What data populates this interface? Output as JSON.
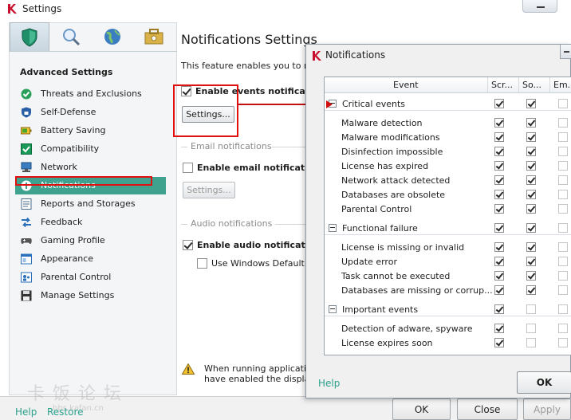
{
  "window": {
    "title": "Settings"
  },
  "tabs": [
    {
      "icon": "shield-icon",
      "color": "#1f8f6a"
    },
    {
      "icon": "magnifier-icon",
      "color": "#6a96c8"
    },
    {
      "icon": "globe-icon",
      "color": "#3a7ec1"
    },
    {
      "icon": "toolbox-icon",
      "color": "#c9a13a"
    }
  ],
  "sidebar": {
    "heading": "Advanced Settings",
    "items": [
      {
        "label": "Threats and Exclusions",
        "icon": "check-circle-icon"
      },
      {
        "label": "Self-Defense",
        "icon": "lock-shield-icon"
      },
      {
        "label": "Battery Saving",
        "icon": "battery-icon"
      },
      {
        "label": "Compatibility",
        "icon": "compat-check-icon"
      },
      {
        "label": "Network",
        "icon": "network-icon"
      },
      {
        "label": "Notifications",
        "icon": "info-icon"
      },
      {
        "label": "Reports and Storages",
        "icon": "reports-icon"
      },
      {
        "label": "Feedback",
        "icon": "arrows-icon"
      },
      {
        "label": "Gaming Profile",
        "icon": "gamepad-icon"
      },
      {
        "label": "Appearance",
        "icon": "appearance-icon"
      },
      {
        "label": "Parental Control",
        "icon": "parental-icon"
      },
      {
        "label": "Manage Settings",
        "icon": "save-icon"
      }
    ],
    "selected": "Notifications"
  },
  "content": {
    "title": "Notifications Settings",
    "description": "This feature enables you to re",
    "events": {
      "checkbox_label": "Enable events notification",
      "checked": true,
      "settings_btn": "Settings..."
    },
    "email": {
      "section": "Email notifications",
      "checkbox_label": "Enable email notifications",
      "checked": false,
      "settings_btn": "Settings..."
    },
    "audio": {
      "section": "Audio notifications",
      "checkbox_label": "Enable audio notifications",
      "checked": true,
      "sub_label": "Use Windows Default s",
      "sub_checked": false
    },
    "warning_lines": [
      "When running applicatio",
      "have enabled the display"
    ]
  },
  "bottom": {
    "help": "Help",
    "restore": "Restore",
    "ok": "OK",
    "close": "Close",
    "apply": "Apply"
  },
  "watermark": {
    "text": "卡饭论坛",
    "url": "bbs.kafan.cn"
  },
  "dialog": {
    "title": "Notifications",
    "columns": [
      "Event",
      "Scr...",
      "So...",
      "Em..."
    ],
    "groups": [
      {
        "name": "Critical events",
        "checks": [
          true,
          true,
          false
        ],
        "items": [
          {
            "label": "Malware detection",
            "checks": [
              true,
              true,
              false
            ]
          },
          {
            "label": "Malware modifications",
            "checks": [
              true,
              true,
              false
            ]
          },
          {
            "label": "Disinfection impossible",
            "checks": [
              true,
              true,
              false
            ]
          },
          {
            "label": "License has expired",
            "checks": [
              true,
              true,
              false
            ]
          },
          {
            "label": "Network attack detected",
            "checks": [
              true,
              true,
              false
            ]
          },
          {
            "label": "Databases are obsolete",
            "checks": [
              true,
              true,
              false
            ]
          },
          {
            "label": "Parental Control",
            "checks": [
              true,
              true,
              false
            ]
          }
        ]
      },
      {
        "name": "Functional failure",
        "checks": [
          true,
          true,
          false
        ],
        "items": [
          {
            "label": "License is missing or invalid",
            "checks": [
              true,
              true,
              false
            ]
          },
          {
            "label": "Update error",
            "checks": [
              true,
              true,
              false
            ]
          },
          {
            "label": "Task cannot be executed",
            "checks": [
              true,
              true,
              false
            ]
          },
          {
            "label": "Databases are missing or corrup...",
            "checks": [
              true,
              true,
              false
            ]
          }
        ]
      },
      {
        "name": "Important events",
        "checks": [
          true,
          false,
          false
        ],
        "items": [
          {
            "label": "Detection of adware, spyware",
            "checks": [
              true,
              false,
              false
            ]
          },
          {
            "label": "License expires soon",
            "checks": [
              true,
              false,
              false
            ]
          }
        ]
      }
    ],
    "help": "Help",
    "ok": "OK"
  },
  "accent": "#3ea28f",
  "highlight": "#e01010"
}
